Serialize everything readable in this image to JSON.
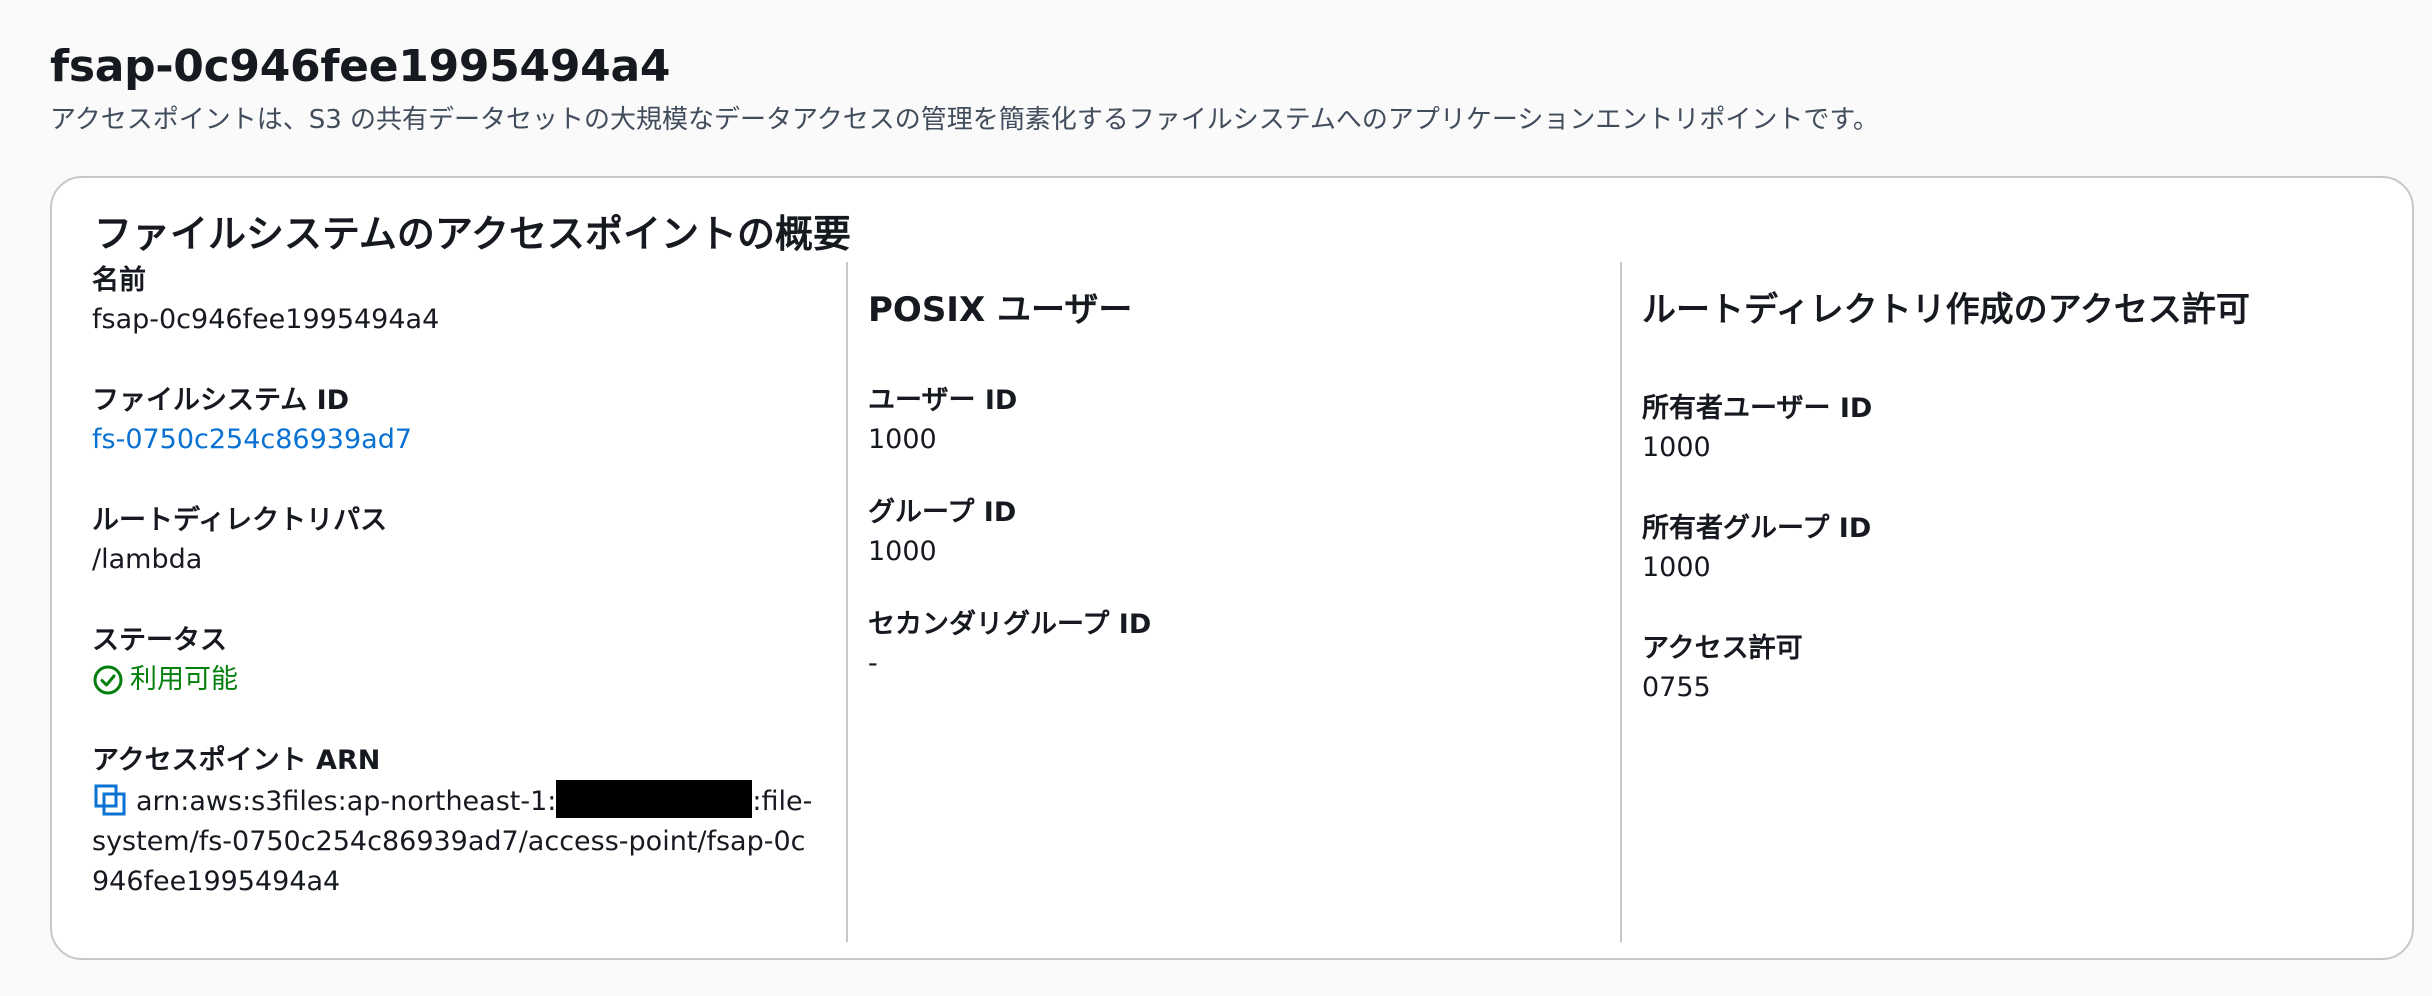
{
  "header": {
    "title": "fsap-0c946fee1995494a4",
    "description": "アクセスポイントは、S3 の共有データセットの大規模なデータアクセスの管理を簡素化するファイルシステムへのアプリケーションエントリポイントです。"
  },
  "overview": {
    "title": "ファイルシステムのアクセスポイントの概要",
    "name_label": "名前",
    "name_value": "fsap-0c946fee1995494a4",
    "fs_id_label": "ファイルシステム ID",
    "fs_id_value": "fs-0750c254c86939ad7",
    "root_path_label": "ルートディレクトリパス",
    "root_path_value": "/lambda",
    "status_label": "ステータス",
    "status_value": "利用可能",
    "status_color": "#037f0c",
    "arn_label": "アクセスポイント ARN",
    "arn_prefix": "arn:aws:s3files:ap-northeast-1:",
    "arn_suffix": ":file-system/fs-0750c254c86939ad7/access-point/fsap-0c946fee1995494a4",
    "arn_icon": "copy-icon"
  },
  "posix": {
    "title": "POSIX ユーザー",
    "user_id_label": "ユーザー ID",
    "user_id_value": "1000",
    "group_id_label": "グループ ID",
    "group_id_value": "1000",
    "secondary_group_label": "セカンダリグループ ID",
    "secondary_group_value": "-"
  },
  "root_permissions": {
    "title": "ルートディレクトリ作成のアクセス許可",
    "owner_user_label": "所有者ユーザー ID",
    "owner_user_value": "1000",
    "owner_group_label": "所有者グループ ID",
    "owner_group_value": "1000",
    "permissions_label": "アクセス許可",
    "permissions_value": "0755"
  },
  "colors": {
    "link": "#0972d3",
    "success": "#037f0c",
    "border": "#c6c6cd"
  }
}
